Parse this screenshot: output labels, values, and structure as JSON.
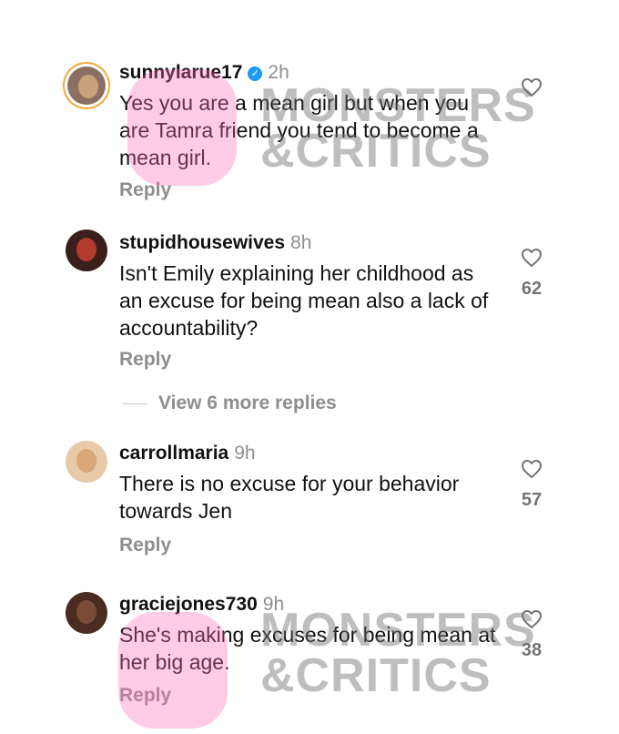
{
  "comments": [
    {
      "username": "sunnylarue17",
      "verified": true,
      "time": "2h",
      "text": "Yes you are a mean girl but when you are Tamra friend you tend to become a mean girl.",
      "reply_label": "Reply",
      "likes": ""
    },
    {
      "username": "stupidhousewives",
      "verified": false,
      "time": "8h",
      "text": "Isn't Emily explaining her childhood as an excuse for being mean also a lack of accountability?",
      "reply_label": "Reply",
      "likes": "62"
    },
    {
      "username": "carrollmaria",
      "verified": false,
      "time": "9h",
      "text": "There is no excuse for your behavior towards Jen",
      "reply_label": "Reply",
      "likes": "57"
    },
    {
      "username": "graciejones730",
      "verified": false,
      "time": "9h",
      "text": "She's making excuses for being mean at her big age.",
      "reply_label": "Reply",
      "likes": "38"
    }
  ],
  "view_more_replies": "View 6 more replies",
  "watermark": {
    "line1": "MONSTERS",
    "line2": "&CRITICS"
  },
  "colors": {
    "secondary_text": "#8e8e8e",
    "verified_blue": "#1d9bf0",
    "watermark_pink": "#ff69b4"
  },
  "icons": {
    "like": "heart-outline-icon",
    "verified": "verified-badge-icon"
  }
}
